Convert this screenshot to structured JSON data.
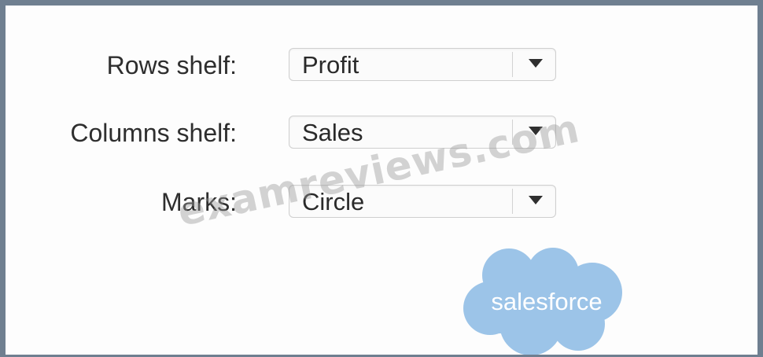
{
  "form": {
    "rows": {
      "label": "Rows shelf:",
      "value": "Profit"
    },
    "columns": {
      "label": "Columns shelf:",
      "value": "Sales"
    },
    "marks": {
      "label": "Marks:",
      "value": "Circle"
    }
  },
  "watermark": "examreviews.com",
  "logo": {
    "text": "salesforce",
    "color": "#9cc4e8"
  },
  "frame_color": "#6f7f90"
}
